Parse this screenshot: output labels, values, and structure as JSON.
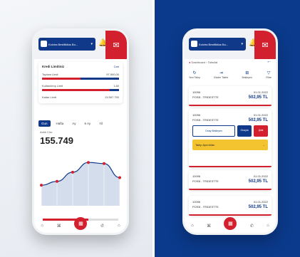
{
  "colors": {
    "brand": "#11398a",
    "accent": "#d3202f",
    "yellow": "#f4c430",
    "right_bg": "#0b3a8c"
  },
  "common": {
    "account_selector": "Kolxtra Bestfiktius Bo...",
    "chevron": "▾",
    "bell": "🔔",
    "mail": "✉"
  },
  "screen1": {
    "limit_title": "Kredi Limitiniz",
    "limit_link": "Cari",
    "rows": [
      {
        "label": "Toplam Limit",
        "value": "97.500,00",
        "red": 0.5,
        "blue": 0.5
      },
      {
        "label": "Kullanılmış Limit",
        "value": "1.80",
        "red": 0.88,
        "blue": 0.12
      },
      {
        "label": "Kalan Limit",
        "value": "13.567.750",
        "red": 0,
        "blue": 0
      }
    ],
    "tabs": [
      "Gun",
      "Hafta",
      "Ay",
      "6 Ay",
      "Yil"
    ],
    "active_tab": 0,
    "sales_label": "Anlık Ciro",
    "sales_value": "155.749",
    "slider_fraction": 0.6
  },
  "chart_data": {
    "type": "area",
    "categories": [
      "",
      "",
      "",
      "",
      "",
      ""
    ],
    "values": [
      38,
      45,
      62,
      80,
      78,
      52
    ],
    "title": "",
    "xlabel": "",
    "ylabel": "",
    "ylim": [
      0,
      100
    ]
  },
  "screen2": {
    "breadcrumb": "Dashboard",
    "breadcrumb_sub": "Tahsilat",
    "back": "←",
    "actions": [
      {
        "icon": "↻",
        "label": "Yeni Talep"
      },
      {
        "icon": "⇥",
        "label": "Ekstre Talebi"
      },
      {
        "icon": "⊞",
        "label": "Bekleyen"
      },
      {
        "icon": "▽",
        "label": "Filtre"
      }
    ],
    "tx": [
      {
        "id": "10096",
        "date": "01.01.2022",
        "type": "POSB - TRIDESTTE",
        "amount": "502,95 TL"
      },
      {
        "id": "10096",
        "date": "01.01.2022",
        "type": "POSB - TRIDESTTE",
        "amount": "502,95 TL"
      },
      {
        "id": "10096",
        "date": "01.01.2022",
        "type": "POSB - TRIDESTTE",
        "amount": "502,95 TL"
      },
      {
        "id": "10096",
        "date": "01.01.2022",
        "type": "POSB - TRIDESTTE",
        "amount": "502,95 TL"
      }
    ],
    "btn_detail": "Onay Bekleyen",
    "btn_approve": "Onayla",
    "btn_cancel": "İptal",
    "yellow_btn": "Talep Ayrıntıları",
    "yellow_arrow": "→"
  },
  "nav": {
    "home": "⌂",
    "bank": "⌘",
    "fab": "▦",
    "chat": "✆",
    "bag": "⌂"
  }
}
